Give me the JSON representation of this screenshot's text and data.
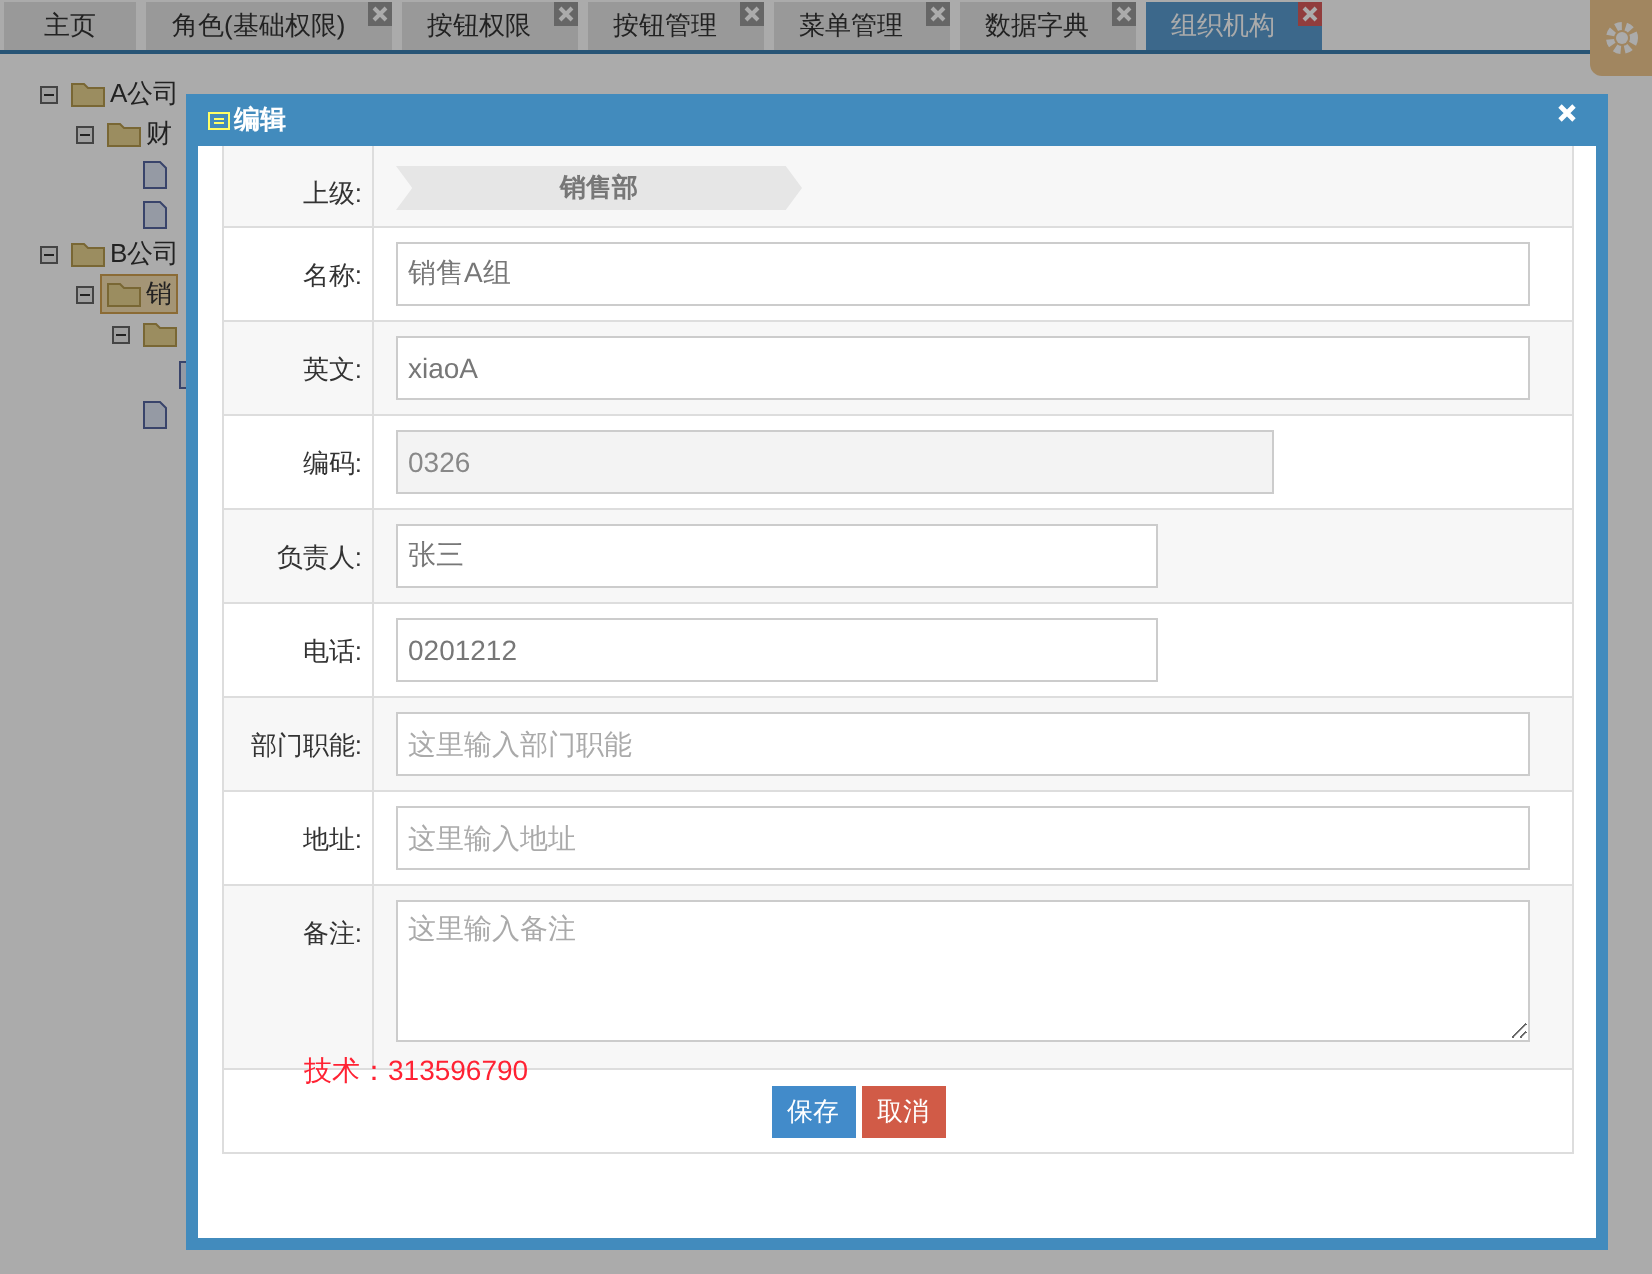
{
  "tabs": [
    {
      "label": "主页",
      "selected": false,
      "closable": false
    },
    {
      "label": "角色(基础权限)",
      "selected": false,
      "closable": true
    },
    {
      "label": "按钮权限",
      "selected": false,
      "closable": true
    },
    {
      "label": "按钮管理",
      "selected": false,
      "closable": true
    },
    {
      "label": "菜单管理",
      "selected": false,
      "closable": true
    },
    {
      "label": "数据字典",
      "selected": false,
      "closable": true
    },
    {
      "label": "组织机构",
      "selected": true,
      "closable": true
    }
  ],
  "tree": [
    {
      "label": "A公司",
      "kind": "folder",
      "selected": false,
      "children": [
        {
          "label": "财",
          "kind": "folder",
          "selected": false,
          "children": [
            {
              "kind": "leaf",
              "selected": false
            },
            {
              "kind": "leaf",
              "selected": false
            }
          ]
        }
      ]
    },
    {
      "label": "B公司",
      "kind": "folder",
      "selected": false,
      "children": [
        {
          "label": "销",
          "kind": "folder",
          "selected": true,
          "children": [
            {
              "kind": "folder",
              "selected": false,
              "children": [
                {
                  "kind": "leaf",
                  "selected": false
                }
              ]
            },
            {
              "kind": "leaf",
              "selected": false
            }
          ]
        }
      ]
    }
  ],
  "dialog": {
    "title": "编辑",
    "fields": [
      {
        "label": "上级:",
        "kind": "parent",
        "value": "销售部"
      },
      {
        "label": "名称:",
        "kind": "long",
        "value": "销售A组",
        "disabled": false
      },
      {
        "label": "英文:",
        "kind": "long",
        "value": "xiaoA",
        "disabled": false
      },
      {
        "label": "编码:",
        "kind": "medium",
        "value": "0326",
        "disabled": true
      },
      {
        "label": "负责人:",
        "kind": "short",
        "value": "张三",
        "disabled": false
      },
      {
        "label": "电话:",
        "kind": "short",
        "value": "0201212",
        "disabled": false
      },
      {
        "label": "部门职能:",
        "kind": "long",
        "placeholder": "这里输入部门职能",
        "disabled": false
      },
      {
        "label": "地址:",
        "kind": "long",
        "placeholder": "这里输入地址",
        "disabled": false
      },
      {
        "label": "备注:",
        "kind": "textarea",
        "placeholder": "这里输入备注",
        "disabled": false
      }
    ],
    "note": "技术：313596790",
    "buttons": [
      {
        "label": "保存",
        "kind": "primary"
      },
      {
        "label": "取消",
        "kind": "danger"
      }
    ]
  }
}
